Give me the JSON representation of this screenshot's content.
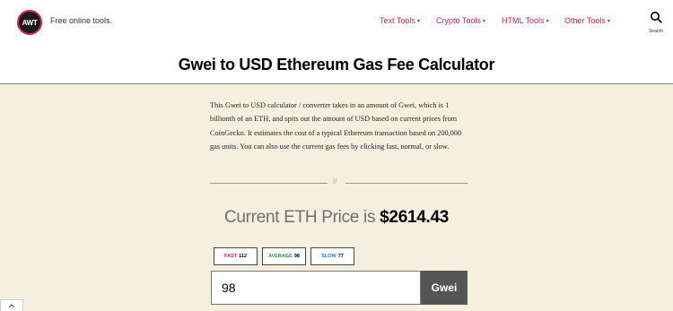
{
  "header": {
    "logo_text": "AWT",
    "tagline": "Free online tools.",
    "nav": [
      {
        "label": "Text Tools"
      },
      {
        "label": "Crypto Tools"
      },
      {
        "label": "HTML Tools"
      },
      {
        "label": "Other Tools"
      }
    ],
    "search_label": "Search"
  },
  "page": {
    "title": "Gwei to USD Ethereum Gas Fee Calculator",
    "intro": "This Gwei to USD calculator / converter takes in an amount of Gwei, which is 1 billionth of an ETH, and spits out the amount of USD based on current prices from CoinGecko. It estimates the cost of a typical Ethereum transaction based on 200,000 gas units. You can also use the current gas fees by clicking fast, normal, or slow.",
    "separator": "//",
    "price_label": "Current ETH Price is",
    "price_value": "$2614.43"
  },
  "fees": [
    {
      "label": "FAST",
      "value": "112",
      "color": "#cd2653"
    },
    {
      "label": "AVERAGE",
      "value": "98",
      "color": "#2e9d3a"
    },
    {
      "label": "SLOW",
      "value": "77",
      "color": "#2a7fc4"
    }
  ],
  "calculator": {
    "input_value": "98",
    "unit_label": "Gwei"
  },
  "colors": {
    "accent": "#cd2653",
    "background": "#f5efe0",
    "unit_button": "#555555"
  }
}
